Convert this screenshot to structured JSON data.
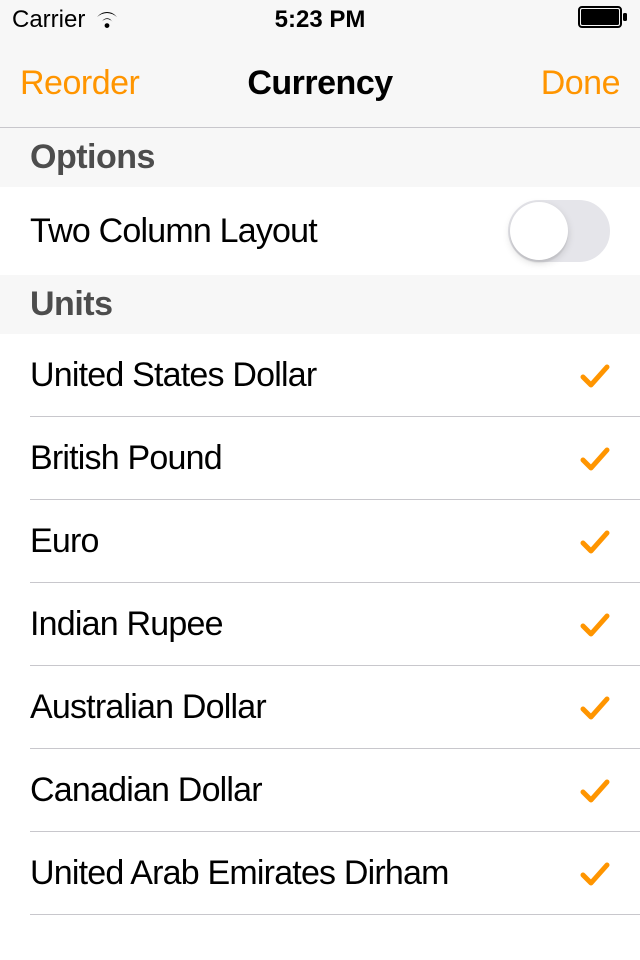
{
  "status_bar": {
    "carrier": "Carrier",
    "time": "5:23 PM"
  },
  "nav": {
    "left": "Reorder",
    "title": "Currency",
    "right": "Done"
  },
  "sections": {
    "options": {
      "header": "Options",
      "two_column_label": "Two Column Layout",
      "two_column_on": false
    },
    "units": {
      "header": "Units",
      "items": [
        {
          "label": "United States Dollar",
          "checked": true
        },
        {
          "label": "British Pound",
          "checked": true
        },
        {
          "label": "Euro",
          "checked": true
        },
        {
          "label": "Indian Rupee",
          "checked": true
        },
        {
          "label": "Australian Dollar",
          "checked": true
        },
        {
          "label": "Canadian Dollar",
          "checked": true
        },
        {
          "label": "United Arab Emirates Dirham",
          "checked": true
        }
      ]
    }
  },
  "colors": {
    "accent": "#ff9500"
  }
}
